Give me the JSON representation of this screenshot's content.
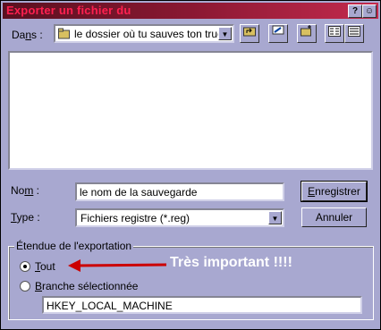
{
  "window": {
    "title": "Exporter un fichier du",
    "help_btn": "?",
    "close_btn": "☺"
  },
  "look_in": {
    "label_pre": "Da",
    "label_u": "n",
    "label_post": "s :",
    "value": "le dossier où tu sauves ton truc"
  },
  "filename": {
    "label_pre": "No",
    "label_u": "m",
    "label_post": " :",
    "value": "le nom de la sauvegarde"
  },
  "filetype": {
    "label_pre": "",
    "label_u": "T",
    "label_post": "ype :",
    "value": "Fichiers registre (*.reg)"
  },
  "buttons": {
    "save_pre": "",
    "save_u": "E",
    "save_post": "nregistrer",
    "cancel": "Annuler"
  },
  "export_range": {
    "title": "Étendue de l'exportation",
    "all_pre": "",
    "all_u": "T",
    "all_post": "out",
    "branch_pre": "",
    "branch_u": "B",
    "branch_post": "ranche sélectionnée",
    "branch_value": "HKEY_LOCAL_MACHINE",
    "selected": "all"
  },
  "annotation": "Très important !!!!",
  "colors": {
    "annotation_arrow": "#cc0000",
    "dialog_bg": "#a8a8d0"
  }
}
